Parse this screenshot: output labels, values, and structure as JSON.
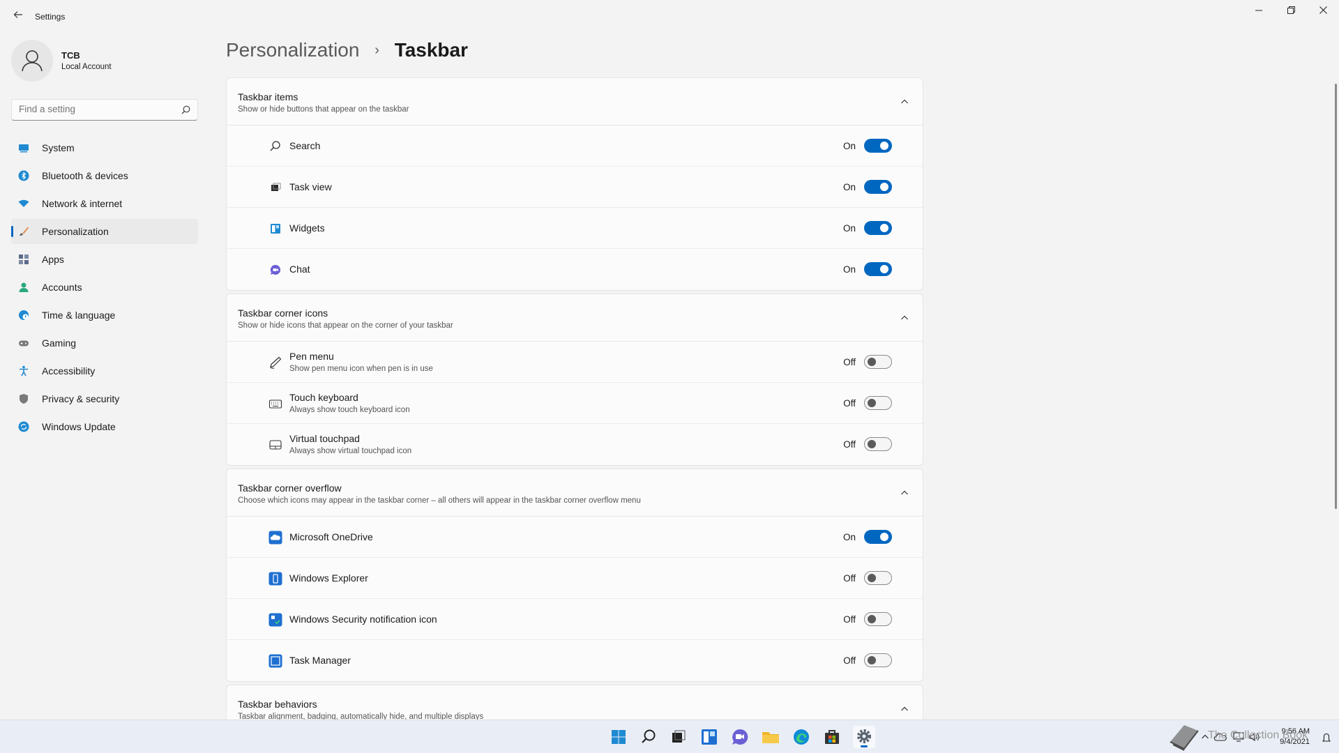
{
  "window": {
    "title": "Settings",
    "back_icon": "back-arrow-icon"
  },
  "profile": {
    "name": "TCB",
    "account_type": "Local Account"
  },
  "search": {
    "placeholder": "Find a setting"
  },
  "sidebar": {
    "items": [
      {
        "label": "System",
        "icon": "system-icon",
        "active": false
      },
      {
        "label": "Bluetooth & devices",
        "icon": "bluetooth-icon",
        "active": false
      },
      {
        "label": "Network & internet",
        "icon": "network-icon",
        "active": false
      },
      {
        "label": "Personalization",
        "icon": "brush-icon",
        "active": true
      },
      {
        "label": "Apps",
        "icon": "apps-icon",
        "active": false
      },
      {
        "label": "Accounts",
        "icon": "accounts-icon",
        "active": false
      },
      {
        "label": "Time & language",
        "icon": "globe-clock-icon",
        "active": false
      },
      {
        "label": "Gaming",
        "icon": "gamepad-icon",
        "active": false
      },
      {
        "label": "Accessibility",
        "icon": "accessibility-icon",
        "active": false
      },
      {
        "label": "Privacy & security",
        "icon": "shield-icon",
        "active": false
      },
      {
        "label": "Windows Update",
        "icon": "update-icon",
        "active": false
      }
    ]
  },
  "breadcrumb": {
    "parent": "Personalization",
    "separator": "›",
    "current": "Taskbar"
  },
  "sections": [
    {
      "title": "Taskbar items",
      "description": "Show or hide buttons that appear on the taskbar",
      "rows": [
        {
          "label": "Search",
          "state": "On",
          "on": true
        },
        {
          "label": "Task view",
          "state": "On",
          "on": true
        },
        {
          "label": "Widgets",
          "state": "On",
          "on": true
        },
        {
          "label": "Chat",
          "state": "On",
          "on": true
        }
      ]
    },
    {
      "title": "Taskbar corner icons",
      "description": "Show or hide icons that appear on the corner of your taskbar",
      "rows": [
        {
          "label": "Pen menu",
          "desc": "Show pen menu icon when pen is in use",
          "state": "Off",
          "on": false
        },
        {
          "label": "Touch keyboard",
          "desc": "Always show touch keyboard icon",
          "state": "Off",
          "on": false
        },
        {
          "label": "Virtual touchpad",
          "desc": "Always show virtual touchpad icon",
          "state": "Off",
          "on": false
        }
      ]
    },
    {
      "title": "Taskbar corner overflow",
      "description": "Choose which icons may appear in the taskbar corner – all others will appear in the taskbar corner overflow menu",
      "rows": [
        {
          "label": "Microsoft OneDrive",
          "state": "On",
          "on": true
        },
        {
          "label": "Windows Explorer",
          "state": "Off",
          "on": false
        },
        {
          "label": "Windows Security notification icon",
          "state": "Off",
          "on": false
        },
        {
          "label": "Task Manager",
          "state": "Off",
          "on": false
        }
      ]
    },
    {
      "title": "Taskbar behaviors",
      "description": "Taskbar alignment, badging, automatically hide, and multiple displays"
    }
  ],
  "taskbar": {
    "clock_time": "9:56 AM",
    "clock_date": "9/4/2021",
    "watermark": "The Collection Book"
  },
  "colors": {
    "accent": "#0067c0",
    "background": "#f3f3f3",
    "card": "#fbfbfb"
  }
}
